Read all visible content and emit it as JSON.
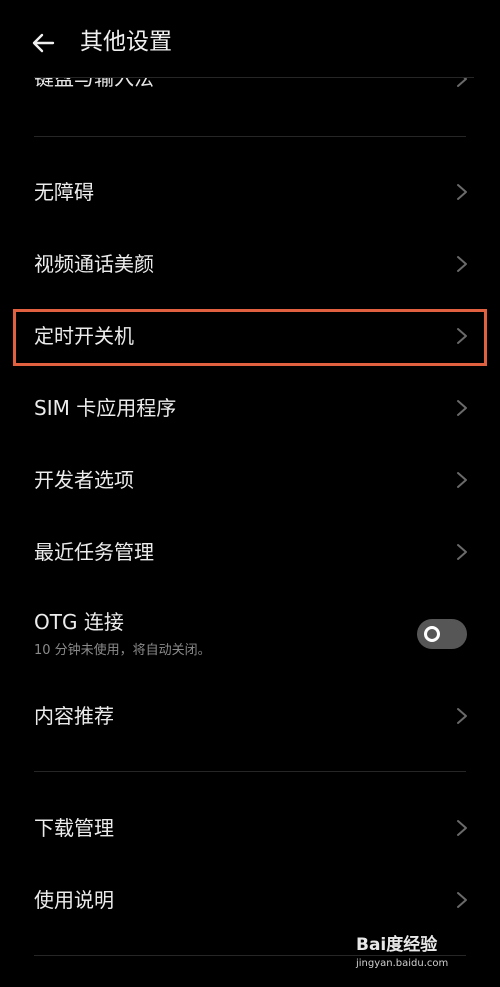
{
  "header": {
    "title": "其他设置",
    "back_icon": "back-arrow-icon"
  },
  "partial_item": {
    "label": "键盘与输入法"
  },
  "items": [
    {
      "label": "无障碍"
    },
    {
      "label": "视频通话美颜"
    },
    {
      "label": "定时开关机",
      "highlighted": true
    },
    {
      "label": "SIM 卡应用程序"
    },
    {
      "label": "开发者选项"
    },
    {
      "label": "最近任务管理"
    }
  ],
  "otg": {
    "label": "OTG 连接",
    "subtitle": "10 分钟未使用，将自动关闭。",
    "enabled": false
  },
  "items2": [
    {
      "label": "内容推荐"
    }
  ],
  "items3": [
    {
      "label": "下载管理"
    },
    {
      "label": "使用说明"
    }
  ],
  "watermark": {
    "brand": "Bai度经验",
    "url": "jingyan.baidu.com"
  },
  "colors": {
    "background": "#000000",
    "text": "#ececec",
    "subtext": "#8a8a8a",
    "divider": "#262626",
    "highlight": "#e06040",
    "toggle_off": "#565656"
  }
}
